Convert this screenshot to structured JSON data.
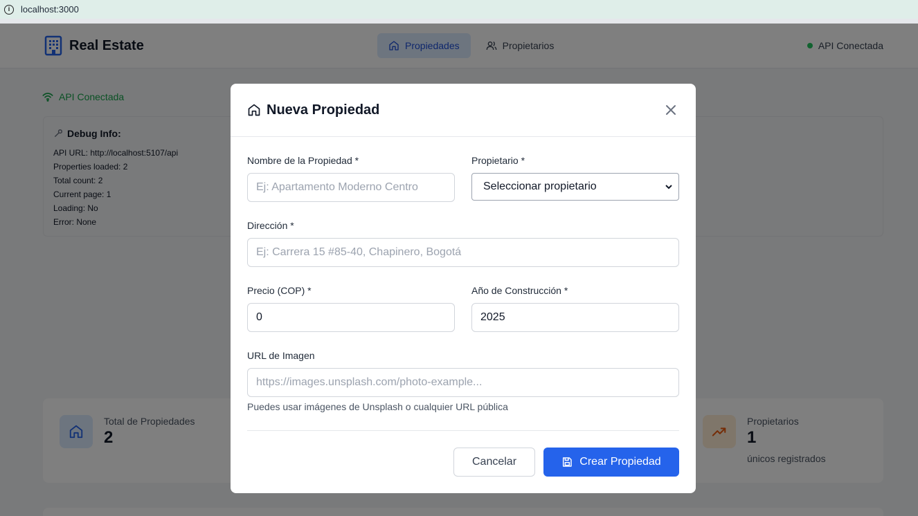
{
  "browser": {
    "url": "localhost:3000"
  },
  "header": {
    "brand": "Real Estate",
    "nav": [
      {
        "label": "Propiedades"
      },
      {
        "label": "Propietarios"
      }
    ],
    "api_status": "API Conectada"
  },
  "background": {
    "connection": "API Conectada",
    "debug": {
      "title": "Debug Info:",
      "lines": [
        "API URL: http://localhost:5107/api",
        "Properties loaded: 2",
        "Total count: 2",
        "Current page: 1",
        "Loading: No",
        "Error: None"
      ]
    },
    "stats": [
      {
        "label": "Total de Propiedades",
        "value": "2",
        "sub": ""
      },
      {
        "label": "Propietarios",
        "value": "1",
        "sub": "únicos registrados"
      }
    ]
  },
  "modal": {
    "title": "Nueva Propiedad",
    "fields": {
      "name": {
        "label": "Nombre de la Propiedad *",
        "placeholder": "Ej: Apartamento Moderno Centro",
        "value": ""
      },
      "owner": {
        "label": "Propietario *",
        "selected": "Seleccionar propietario"
      },
      "address": {
        "label": "Dirección *",
        "placeholder": "Ej: Carrera 15 #85-40, Chapinero, Bogotá",
        "value": ""
      },
      "price": {
        "label": "Precio (COP) *",
        "value": "0"
      },
      "year": {
        "label": "Año de Construcción *",
        "value": "2025"
      },
      "image": {
        "label": "URL de Imagen",
        "placeholder": "https://images.unsplash.com/photo-example...",
        "hint": "Puedes usar imágenes de Unsplash o cualquier URL pública"
      }
    },
    "buttons": {
      "cancel": "Cancelar",
      "create": "Crear Propiedad"
    }
  },
  "colors": {
    "primary": "#2563eb",
    "success": "#22c55e",
    "overlay": "rgba(0,0,0,0.5)"
  }
}
